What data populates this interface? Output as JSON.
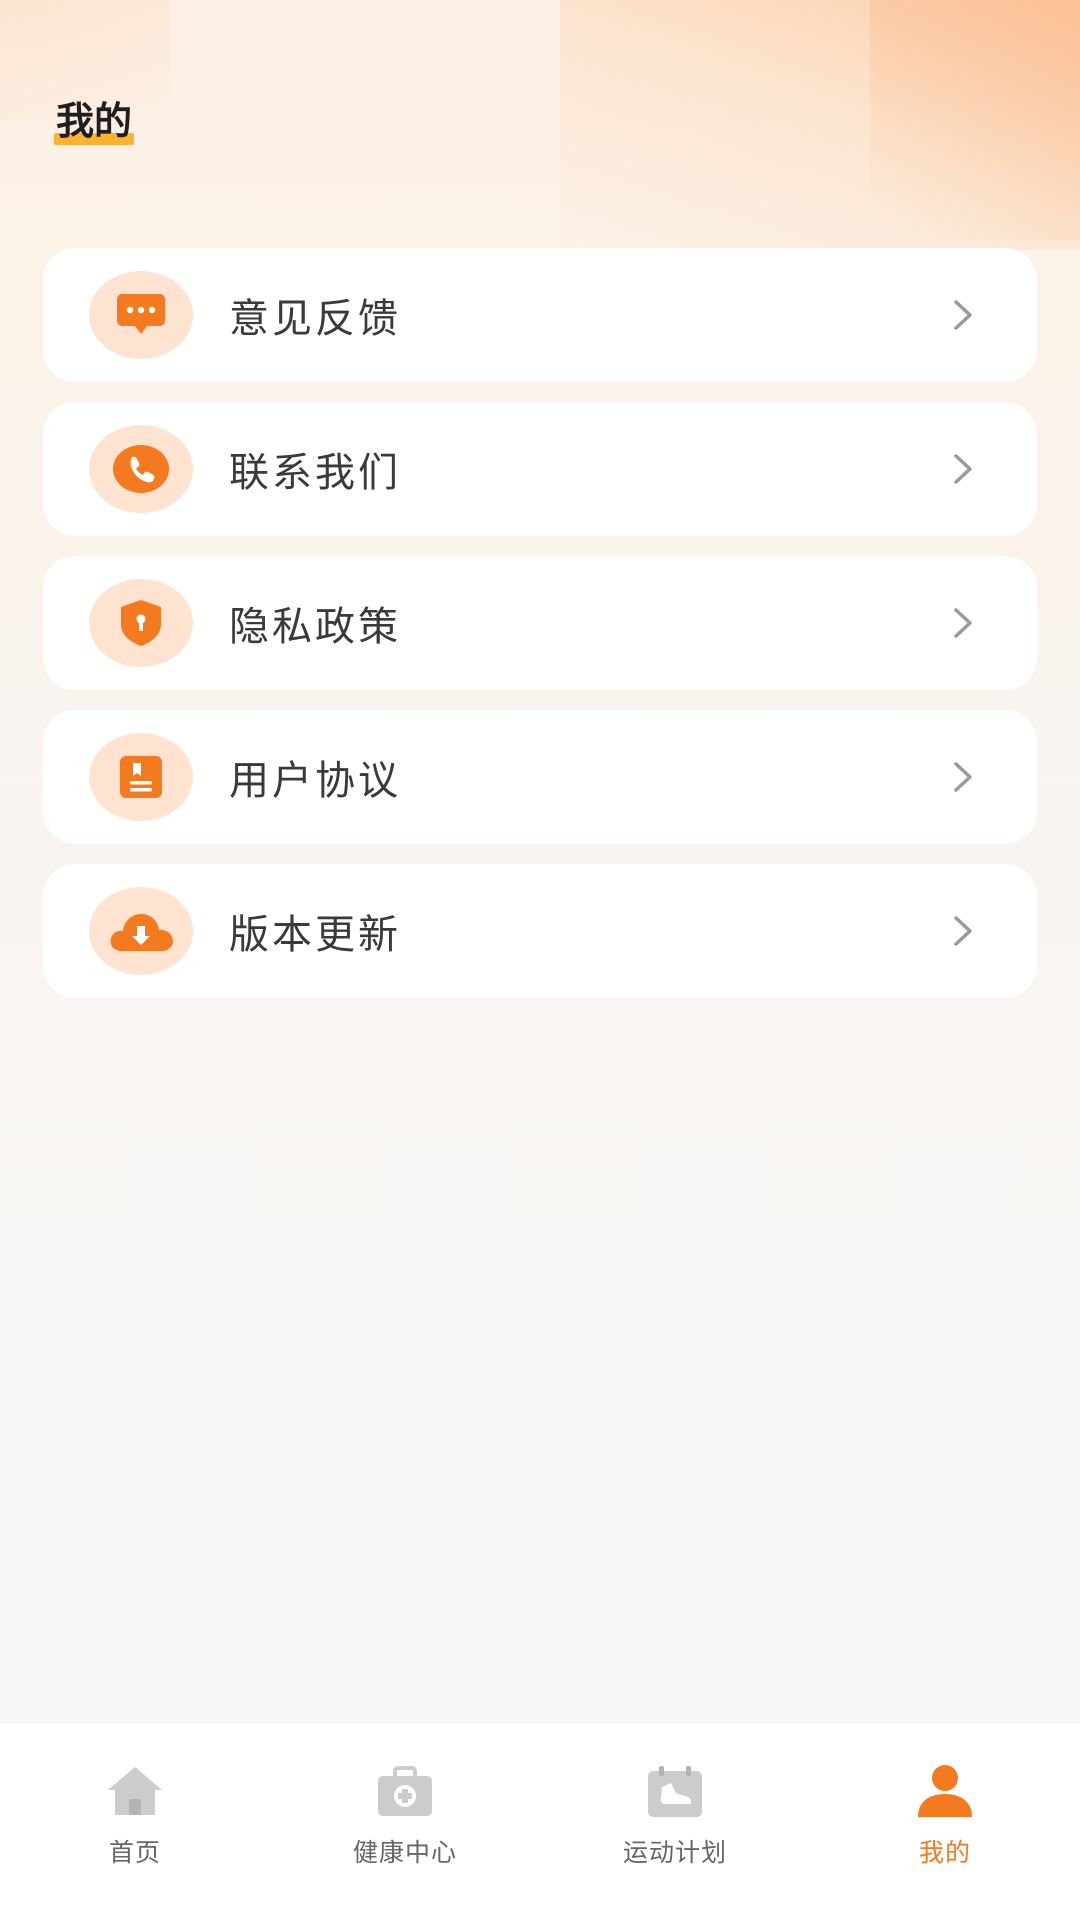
{
  "page": {
    "title": "我的"
  },
  "menu": {
    "items": [
      {
        "label": "意见反馈",
        "icon": "message-icon"
      },
      {
        "label": "联系我们",
        "icon": "phone-icon"
      },
      {
        "label": "隐私政策",
        "icon": "shield-lock-icon"
      },
      {
        "label": "用户协议",
        "icon": "document-icon"
      },
      {
        "label": "版本更新",
        "icon": "cloud-download-icon"
      }
    ]
  },
  "tabbar": {
    "items": [
      {
        "label": "首页",
        "icon": "home-icon",
        "active": false
      },
      {
        "label": "健康中心",
        "icon": "medical-kit-icon",
        "active": false
      },
      {
        "label": "运动计划",
        "icon": "sneaker-calendar-icon",
        "active": false
      },
      {
        "label": "我的",
        "icon": "user-icon",
        "active": true
      }
    ]
  },
  "colors": {
    "accent": "#f37a1f",
    "icon_bg": "#ffe3d1",
    "tab_inactive": "#cccccc",
    "title_highlight": "#ffb22e"
  }
}
